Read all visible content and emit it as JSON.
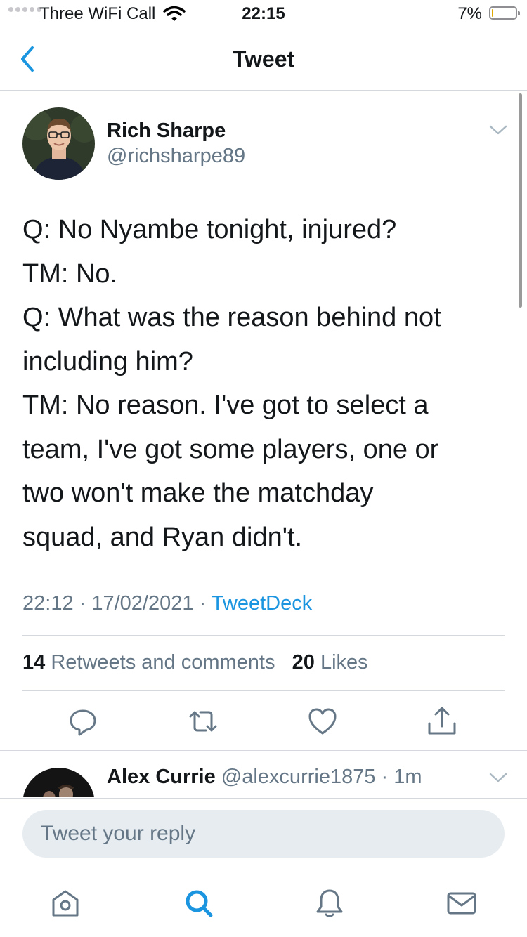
{
  "status_bar": {
    "carrier": "Three WiFi Call",
    "time": "22:15",
    "battery_percent": "7%",
    "battery_level": 0.07,
    "wifi_icon": "wifi-icon"
  },
  "nav": {
    "title": "Tweet",
    "back_icon": "chevron-left-icon"
  },
  "tweet": {
    "author_name": "Rich Sharpe",
    "author_handle": "@richsharpe89",
    "text_lines": [
      "Q: No Nyambe tonight, injured?",
      "TM: No.",
      "Q: What was the reason behind not",
      "including him?",
      "TM: No reason. I've got to select a",
      "team, I've got some players, one or",
      "two won't make the matchday",
      "squad, and Ryan didn't."
    ],
    "time": "22:12",
    "date": "17/02/2021",
    "separator": " · ",
    "source": "TweetDeck",
    "retweets_count": "14",
    "retweets_label": "Retweets and comments",
    "likes_count": "20",
    "likes_label": "Likes"
  },
  "actions": {
    "reply_icon": "reply-icon",
    "retweet_icon": "retweet-icon",
    "like_icon": "heart-icon",
    "share_icon": "share-icon"
  },
  "reply_preview": {
    "author_name": "Alex Currie",
    "author_handle": "@alexcurrie1875",
    "time": "· 1m"
  },
  "reply_box": {
    "placeholder": "Tweet your reply"
  },
  "tab_bar": {
    "items": [
      "home-icon",
      "search-icon",
      "notifications-icon",
      "messages-icon"
    ]
  },
  "colors": {
    "accent": "#1b95e0",
    "secondary_text": "#657786",
    "divider": "#d5d9dd"
  }
}
